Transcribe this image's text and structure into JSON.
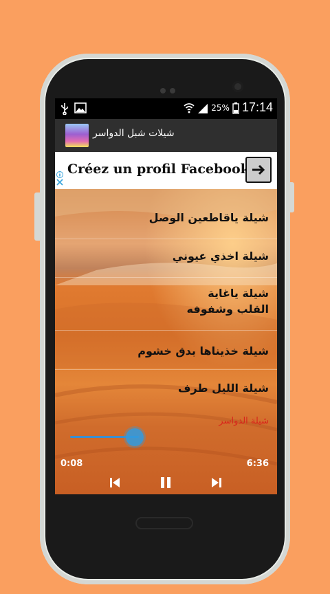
{
  "status": {
    "battery": "25%",
    "time": "17:14"
  },
  "app": {
    "title": "شيلات شبل الدواسر"
  },
  "ad": {
    "text": "Créez un profil Facebook »"
  },
  "songs": [
    {
      "title": "شيلة ياقاطعين الوصل"
    },
    {
      "title": "شيلة اخذي عيوني"
    },
    {
      "title": "شيلة ياغاية القلب وشفوفه"
    },
    {
      "title": "شيلة خذيناها بدق خشوم"
    },
    {
      "title": "شيلة الليل طرف"
    }
  ],
  "player": {
    "now_playing": "شيلة الدواسر",
    "elapsed": "0:08",
    "duration": "6:36",
    "progress_fraction": 0.35
  },
  "colors": {
    "background": "#FA9F5F",
    "accent": "#3A8ED1",
    "now_playing": "#D8241B"
  },
  "icons": [
    "usb-icon",
    "image-icon",
    "wifi-icon",
    "signal-icon",
    "battery-icon",
    "arrow-right-icon",
    "previous-icon",
    "pause-icon",
    "next-icon"
  ]
}
